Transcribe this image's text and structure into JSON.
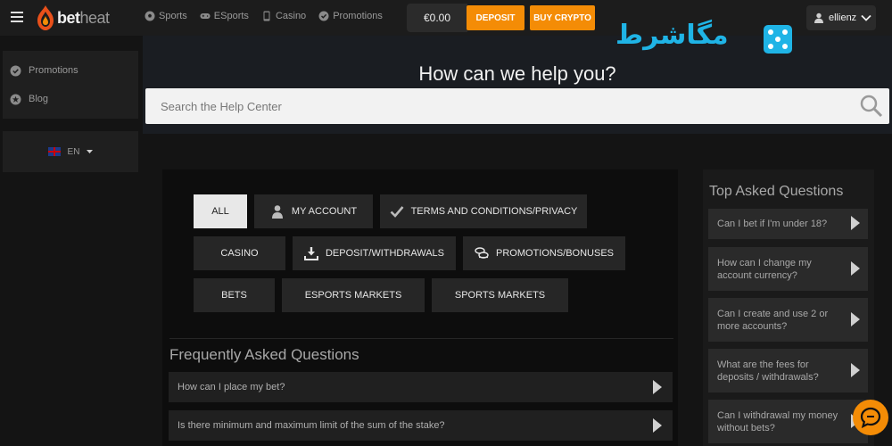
{
  "header": {
    "logo_text_bet": "bet",
    "logo_text_heat": "heat",
    "nav": [
      {
        "label": "Sports",
        "icon": "soccer-ball-icon"
      },
      {
        "label": "ESports",
        "icon": "gamepad-icon"
      },
      {
        "label": "Casino",
        "icon": "phone-icon"
      },
      {
        "label": "Promotions",
        "icon": "badge-check-icon"
      }
    ],
    "balance": "€0.00",
    "deposit_label": "DEPOSIT",
    "buy_crypto_label": "BUY CRYPTO",
    "username": "ellienz",
    "accent": "#f48c06"
  },
  "watermark": {
    "text": "مگاشرط",
    "color": "#1fb4e6"
  },
  "sidebar": {
    "items": [
      {
        "label": "Promotions",
        "icon": "badge-check-icon"
      },
      {
        "label": "Blog",
        "icon": "star-icon"
      }
    ],
    "language": "EN"
  },
  "hero": {
    "title": "How can we help you?",
    "search_placeholder": "Search the Help Center"
  },
  "categories": [
    {
      "label": "ALL",
      "active": true
    },
    {
      "label": "MY ACCOUNT",
      "icon": "user-icon"
    },
    {
      "label": "TERMS AND CONDITIONS/PRIVACY",
      "icon": "checkmark-icon"
    },
    {
      "label": "CASINO"
    },
    {
      "label": "DEPOSIT/WITHDRAWALS",
      "icon": "download-icon"
    },
    {
      "label": "PROMOTIONS/BONUSES",
      "icon": "coins-icon"
    },
    {
      "label": "BETS"
    },
    {
      "label": "ESPORTS MARKETS"
    },
    {
      "label": "SPORTS MARKETS"
    }
  ],
  "faq": {
    "title": "Frequently Asked Questions",
    "items": [
      "How can I place my bet?",
      "Is there minimum and maximum limit of the sum of the stake?"
    ]
  },
  "top_questions": {
    "title": "Top Asked Questions",
    "items": [
      "Can I bet if I'm under 18?",
      "How can I change my account currency?",
      "Can I create and use 2 or more accounts?",
      "What are the fees for deposits / withdrawals?",
      "Can I withdrawal my money without bets?"
    ]
  }
}
